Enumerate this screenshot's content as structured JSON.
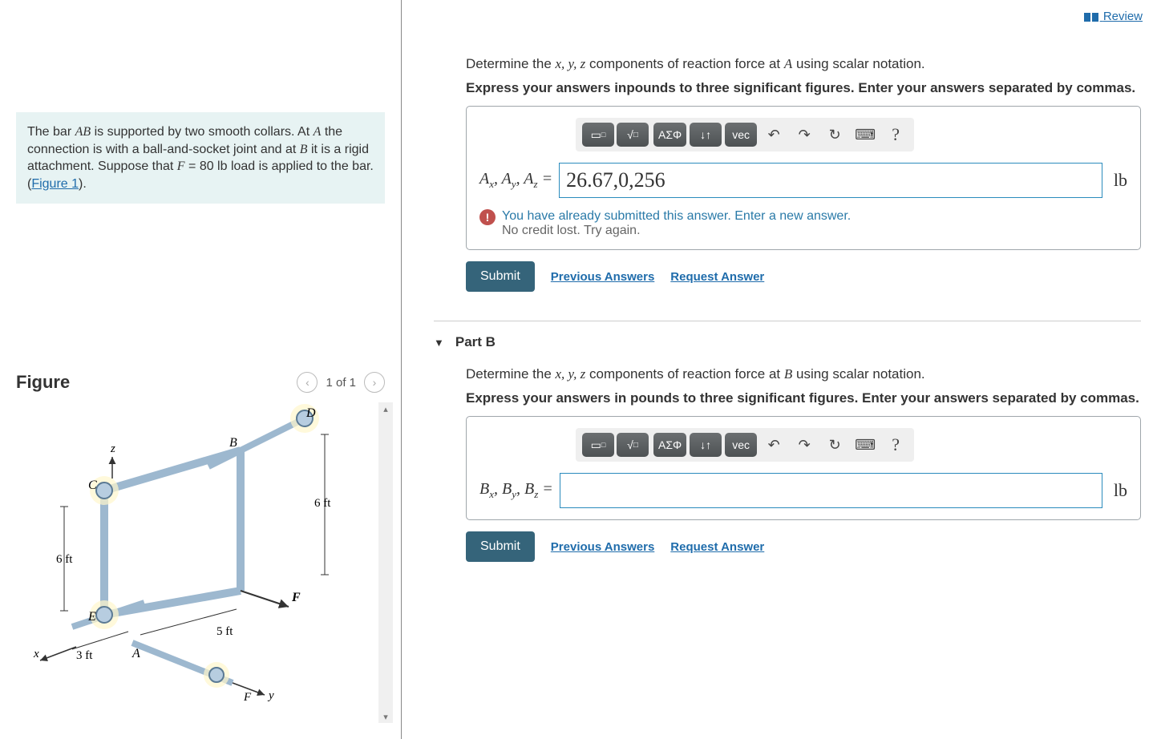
{
  "header": {
    "review_label": "Review"
  },
  "problem": {
    "text_pre": "The bar ",
    "bar": "AB",
    "text_mid1": " is supported by two smooth collars. At ",
    "A": "A",
    "text_mid2": " the connection is with a ball-and-socket joint and at ",
    "B": "B",
    "text_mid3": " it is a rigid attachment. Suppose that ",
    "Fvar": "F",
    "text_mid4": " = 80 lb load is applied to the bar. (",
    "figure_link": "Figure 1",
    "text_end": ")."
  },
  "figure": {
    "heading": "Figure",
    "pager": "1 of 1",
    "labels": {
      "A": "A",
      "B": "B",
      "C": "C",
      "D": "D",
      "E": "E",
      "F": "F",
      "x": "x",
      "y": "y",
      "z": "z"
    },
    "dims": {
      "h6a": "6 ft",
      "h6b": "6 ft",
      "w5": "5 ft",
      "w3": "3 ft"
    }
  },
  "partA": {
    "desc_pre": "Determine the ",
    "vars": "x, y, z",
    "desc_post": " components of reaction force at ",
    "point": "A",
    "desc_end": " using scalar notation.",
    "instruction": "Express your answers inpounds to three significant figures. Enter your answers separated by commas.",
    "var_label_html": "A_x, A_y, A_z =",
    "value": "26.67,0,256",
    "unit": "lb",
    "feedback_l1": "You have already submitted this answer. Enter a new answer.",
    "feedback_l2": "No credit lost. Try again.",
    "submit": "Submit",
    "prev": "Previous Answers",
    "request": "Request Answer"
  },
  "partB": {
    "header": "Part B",
    "desc_pre": "Determine the ",
    "vars": "x, y, z",
    "desc_post": " components of reaction force at ",
    "point": "B",
    "desc_end": " using scalar notation.",
    "instruction": "Express your answers in pounds to three significant figures. Enter your answers separated by commas.",
    "var_label_html": "B_x, B_y, B_z =",
    "value": "",
    "unit": "lb",
    "submit": "Submit",
    "prev": "Previous Answers",
    "request": "Request Answer"
  },
  "toolbar": {
    "template": "▭",
    "fraction": "√",
    "greek": "ΑΣΦ",
    "subsup": "↓↑",
    "vec": "vec",
    "undo": "↶",
    "redo": "↷",
    "reset": "↻",
    "keyboard": "⌨",
    "help": "?"
  }
}
